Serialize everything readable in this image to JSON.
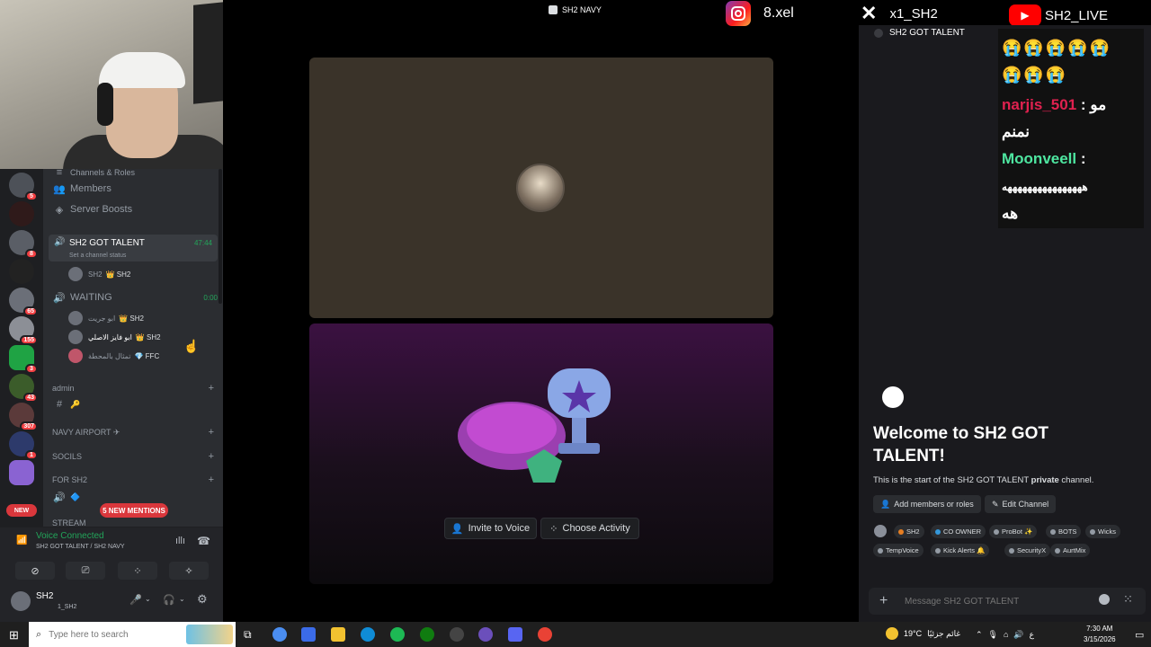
{
  "overlay": {
    "channel_label": "SH2 NAVY",
    "instagram_handle": "8.xel",
    "x_handle": "x1_SH2",
    "youtube_handle": "SH2_LIVE",
    "voice_channel_header": "SH2 GOT TALENT"
  },
  "chat": {
    "emoji_row": "😭😭😭😭😭 😭😭😭",
    "messages": [
      {
        "user": "narjis_501",
        "separator": ":",
        "text_a": "مو",
        "text_b": "نمنم",
        "color": "#e0214f"
      },
      {
        "user": "Moonveell",
        "separator": ":",
        "text_a": "ههههههههههههههههه",
        "text_b": "هه",
        "color": "#4ee6a0"
      }
    ]
  },
  "sidebar": {
    "top_cut_label": "Channels & Roles",
    "members_label": "Members",
    "boosts_label": "Server Boosts",
    "active_voice": {
      "name": "SH2 GOT TALENT",
      "timer": "47:44",
      "status": "Set a channel status"
    },
    "active_user": {
      "name": "SH2",
      "role": "👑 SH2"
    },
    "waiting": {
      "name": "WAITING",
      "timer": "0:00"
    },
    "waiting_users": [
      {
        "name": "ابو جريت",
        "role": "👑 SH2"
      },
      {
        "name": "ابو فايز الاصلي",
        "role": "👑 SH2"
      },
      {
        "name": "تمثال بالمحطة",
        "role": "💎 FFC"
      }
    ],
    "categories": [
      "admin",
      "NAVY AIRPORT ✈",
      "SOCILS",
      "FOR SH2",
      "STREAM"
    ],
    "mentions_pill": "5 NEW MENTIONS",
    "guild_badges": [
      "5",
      "8",
      "65",
      "155",
      "3",
      "43",
      "307",
      "1",
      "NEW"
    ]
  },
  "voice": {
    "status": "Voice Connected",
    "location": "SH2 GOT TALENT / SH2 NAVY"
  },
  "user": {
    "name": "SH2",
    "tag": "1_SH2"
  },
  "stage": {
    "invite_label": "Invite to Voice",
    "activity_label": "Choose Activity"
  },
  "welcome": {
    "title": "Welcome to SH2 GOT TALENT!",
    "desc_prefix": "This is the start of the SH2 GOT TALENT ",
    "desc_bold": "private",
    "desc_suffix": " channel.",
    "add_members_label": "Add members or roles",
    "edit_channel_label": "Edit Channel",
    "tags": [
      "SH2",
      "CO OWNER",
      "ProBot ✨",
      "BOTS",
      "Wicks",
      "TempVoice",
      "Kick Alerts 🔔",
      "SecurityX",
      "AurtMix"
    ],
    "message_placeholder": "Message SH2 GOT TALENT"
  },
  "taskbar": {
    "search_placeholder": "Type here to search",
    "weather": "19°C",
    "weather_desc": "غائم جزئيًا",
    "lang": "ع",
    "time": "7:30 AM",
    "date": "3/15/2026"
  },
  "colors": {
    "discord_bg": "#2b2d31",
    "accent_green": "#23a55a",
    "mention_red": "#da373c"
  }
}
